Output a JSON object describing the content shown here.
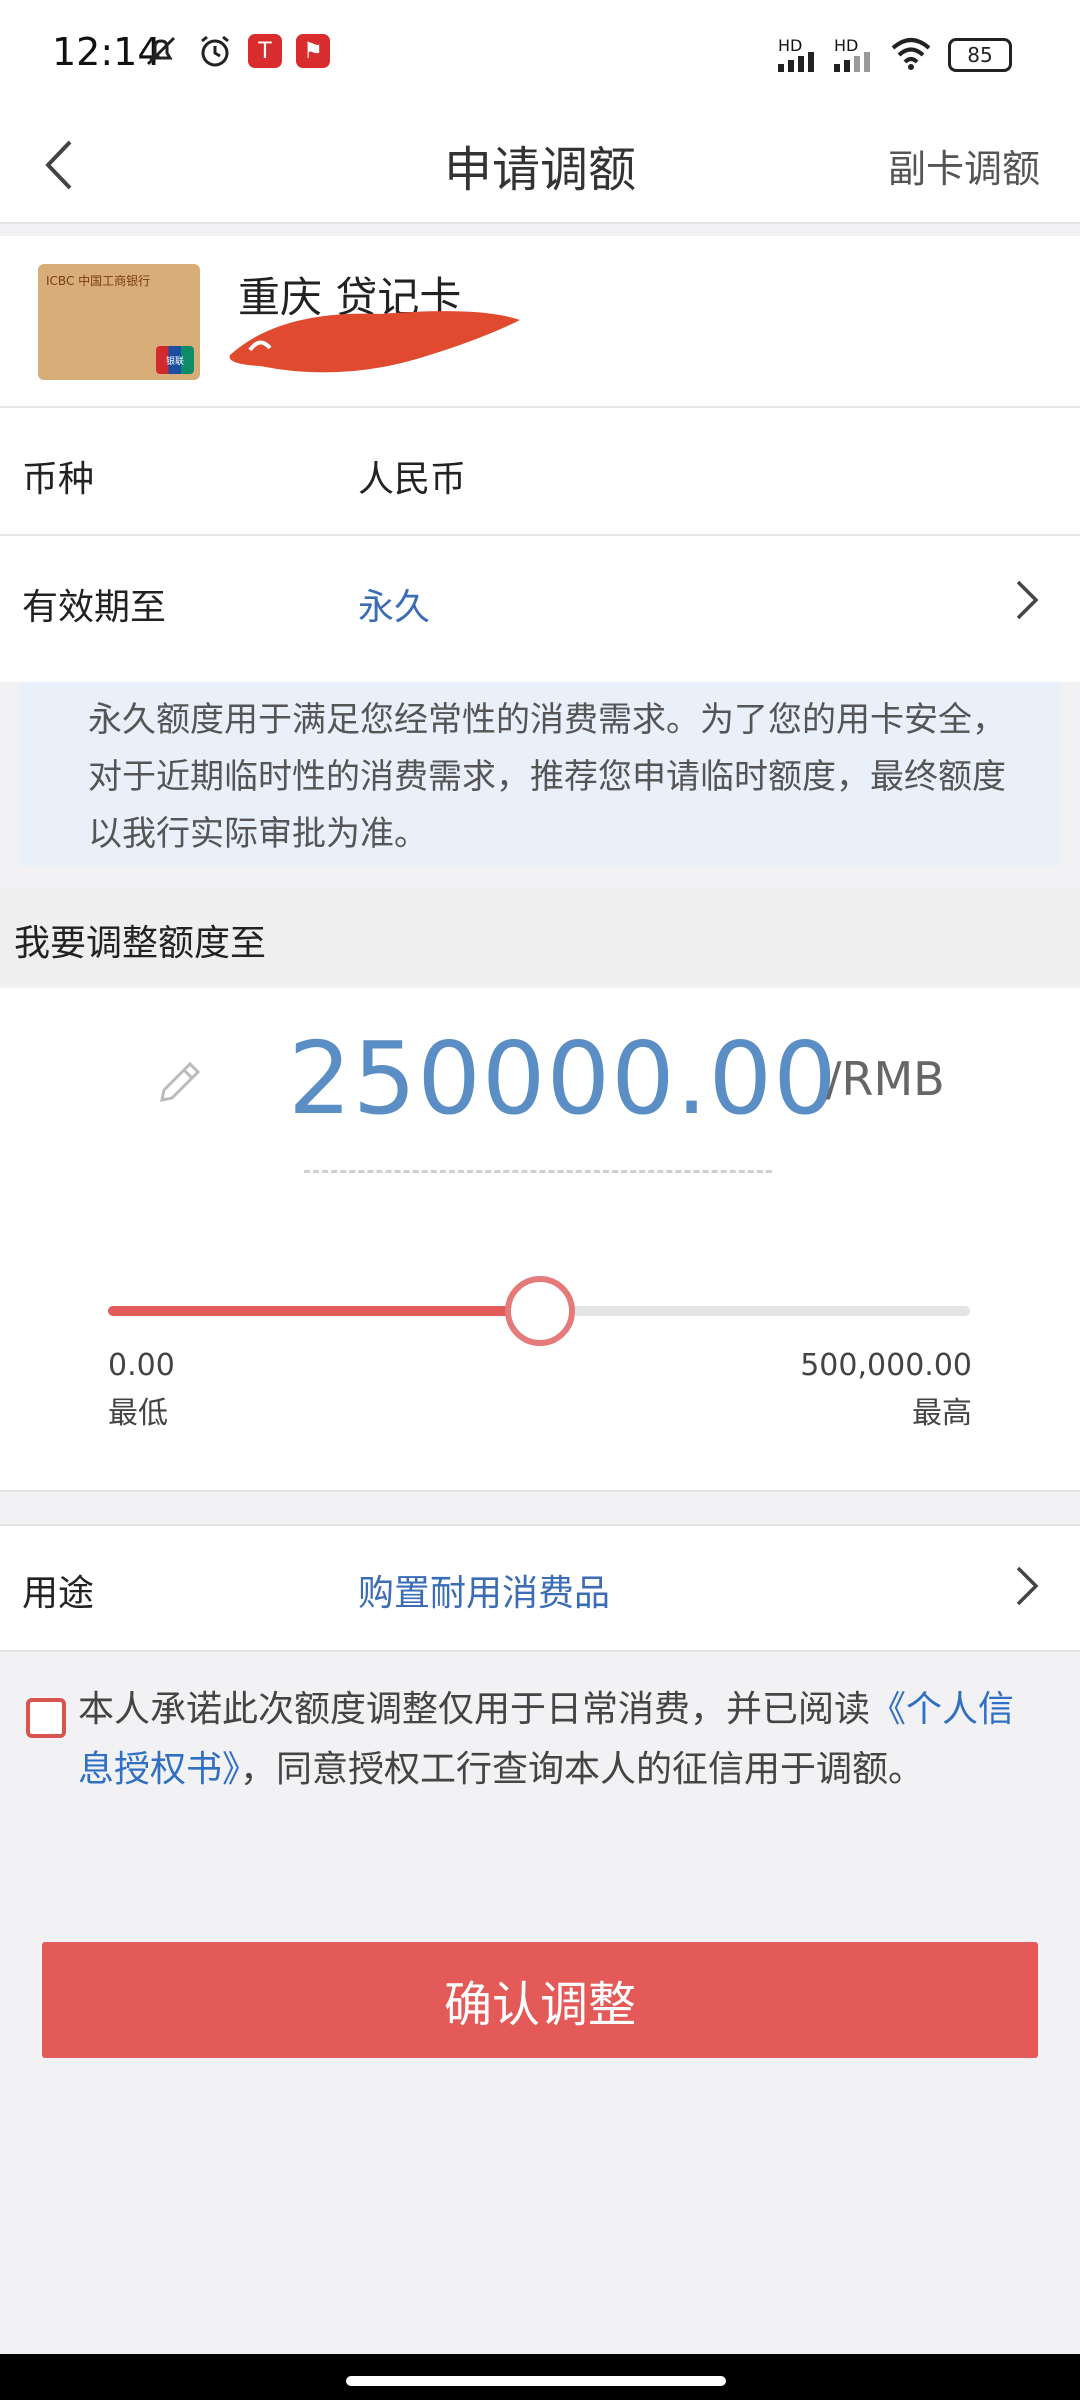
{
  "status_bar": {
    "time": "12:14",
    "battery": "85",
    "signal_label_1": "HD",
    "signal_label_2": "HD",
    "app_icon_1": "T",
    "app_icon_2": "⚑"
  },
  "nav": {
    "title": "申请调额",
    "right_label": "副卡调额"
  },
  "card": {
    "name": "重庆 贷记卡",
    "image_brand_text": "ICBC 中国工商银行",
    "image_logo_text": "银联"
  },
  "rows": {
    "currency_label": "币种",
    "currency_value": "人民币",
    "validity_label": "有效期至",
    "validity_value": "永久",
    "purpose_label": "用途",
    "purpose_value": "购置耐用消费品"
  },
  "notice": "永久额度用于满足您经常性的消费需求。为了您的用卡安全，对于近期临时性的消费需求，推荐您申请临时额度，最终额度以我行实际审批为准。",
  "adjust": {
    "section_title": "我要调整额度至",
    "amount": "250000.00",
    "unit": "/RMB",
    "min_value": "0.00",
    "min_label": "最低",
    "max_value": "500,000.00",
    "max_label": "最高",
    "slider_fraction": 0.5
  },
  "agreement": {
    "text_before": "本人承诺此次额度调整仅用于日常消费，并已阅读",
    "link": "《个人信息授权书》",
    "text_after": "，同意授权工行查询本人的征信用于调额。",
    "checked": false
  },
  "confirm_button": "确认调整",
  "colors": {
    "accent_red": "#e45a58",
    "link_blue": "#2f6fc4",
    "amount_blue": "#5b8ec4",
    "notice_bg": "#e9f0fa"
  }
}
